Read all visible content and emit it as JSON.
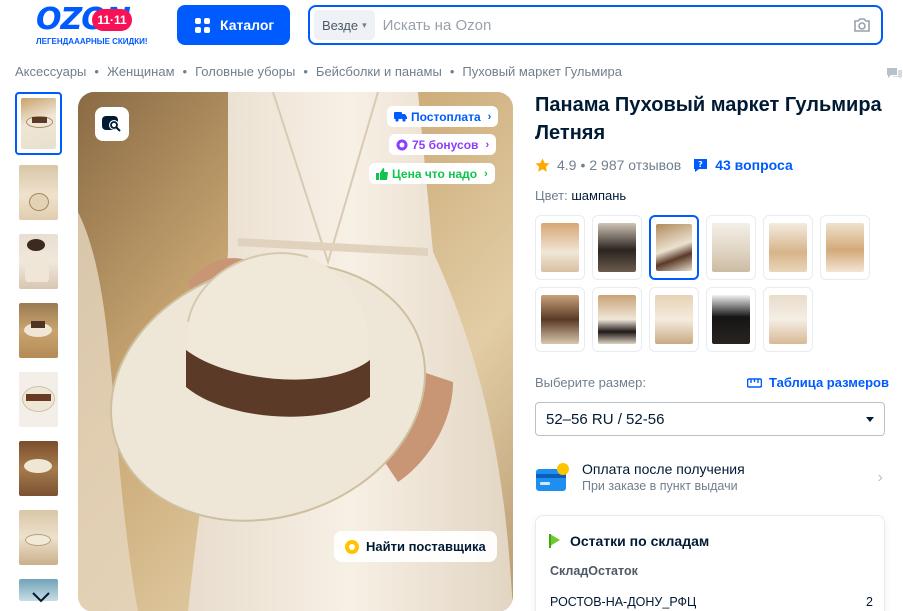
{
  "header": {
    "logo_text": "OZON",
    "logo_badge": "11·11",
    "logo_tagline": "ЛЕГЕНДАААРНЫЕ СКИДКИ!",
    "catalog_label": "Каталог",
    "search_scope": "Везде",
    "search_placeholder": "Искать на Ozon"
  },
  "breadcrumbs": [
    "Аксессуары",
    "Женщинам",
    "Головные уборы",
    "Бейсболки и панамы",
    "Пуховый маркет Гульмира"
  ],
  "gallery": {
    "badges": {
      "postpay": "Постоплата",
      "bonus": "75 бонусов",
      "good_price": "Цена что надо"
    },
    "find_supplier": "Найти поставщика"
  },
  "product": {
    "title": "Панама Пуховый маркет Гульмира Летняя",
    "rating": "4.9",
    "dot": "•",
    "reviews": "2 987 отзывов",
    "questions": "43 вопроса",
    "color_label": "Цвет:",
    "color_value": "шампань",
    "size_label": "Выберите размер:",
    "size_table": "Таблица размеров",
    "size_selected": "52–56 RU / 52-56"
  },
  "payment": {
    "title": "Оплата после получения",
    "subtitle": "При заказе в пункт выдачи"
  },
  "stock": {
    "title": "Остатки по складам",
    "col_warehouse": "Склад",
    "col_remainder": "Остаток",
    "rows": [
      {
        "warehouse": "РОСТОВ-НА-ДОНУ_РФЦ",
        "qty": "2"
      }
    ]
  },
  "colors": {
    "brand_blue": "#005bff",
    "ozon_pink": "#f91155",
    "bonus_purple": "#8b3ffd",
    "good_price_green": "#10c44c",
    "star": "#ffa800"
  },
  "icons": [
    "grid-icon",
    "camera-icon",
    "chat-icon",
    "zoom-search-icon",
    "chevron-down-icon",
    "star-icon",
    "qa-icon",
    "ruler-icon",
    "card-icon",
    "flag-icon"
  ]
}
